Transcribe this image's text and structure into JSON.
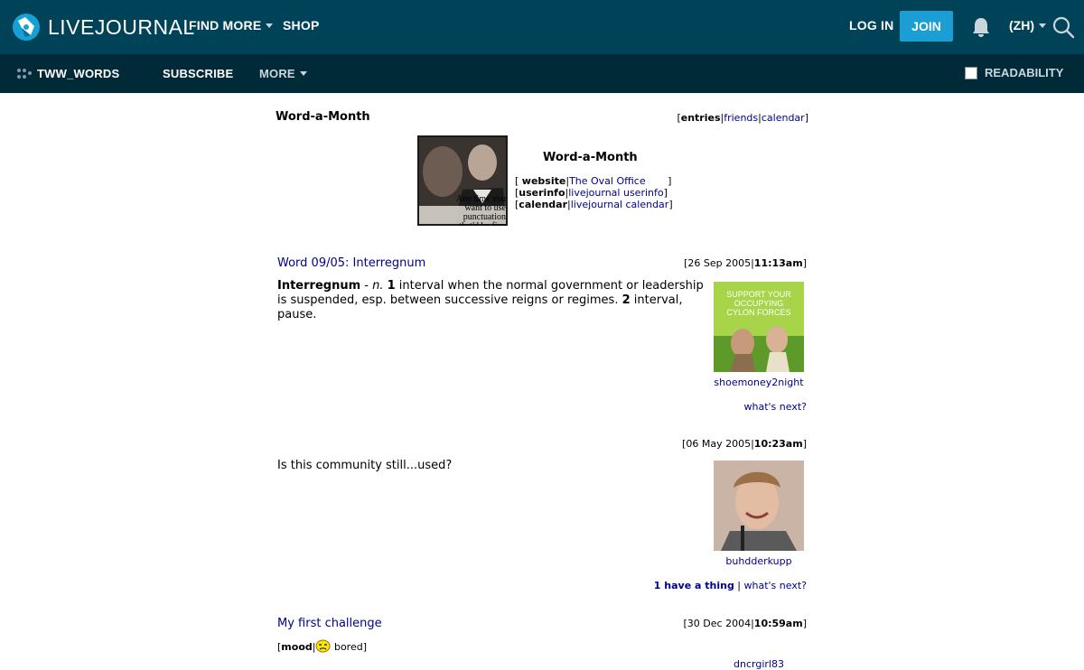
{
  "topnav": {
    "logo_text": "LIVEJOURNAL",
    "find_more": "FIND MORE",
    "shop": "SHOP",
    "login": "LOG IN",
    "join": "JOIN",
    "language": "(ZH)",
    "icons": [
      "livejournal-logo-icon",
      "bell-icon",
      "search-icon"
    ]
  },
  "subnav": {
    "journal_name": "TWW_WORDS",
    "subscribe": "SUBSCRIBE",
    "more": "MORE",
    "readability": "READABILITY"
  },
  "journal": {
    "title": "Word-a-Month",
    "links": {
      "entries": "entries",
      "friends": "friends",
      "calendar": "calendar"
    },
    "header": {
      "title": "Word-a-Month",
      "userpic_caption": "Any time you want to use punctuation that'd be fine",
      "rows": [
        {
          "label": "website",
          "value": "The Oval Office"
        },
        {
          "label": "userinfo",
          "value": "livejournal userinfo"
        },
        {
          "label": "calendar",
          "value": "livejournal calendar"
        }
      ]
    }
  },
  "entries": [
    {
      "subject": "Word 09/05: Interregnum",
      "date": "26 Sep 2005",
      "time": "11:13am",
      "body_term": "Interregnum",
      "body_pos": "n.",
      "body_n1": "1",
      "body_def1": "interval when the normal government or leadership is suspended, esp. between successive reigns or regimes.",
      "body_n2": "2",
      "body_def2": "interval, pause.",
      "userpic_caption": "SUPPORT YOUR OCCUPYING CYLON FORCES",
      "user": "shoemoney2night",
      "whats_next": "what's next?"
    },
    {
      "subject": "",
      "date": "06 May 2005",
      "time": "10:23am",
      "body": "Is this community still...used?",
      "user": "buhdderkupp",
      "comments": "1 have a thing",
      "whats_next": "what's next?"
    },
    {
      "subject": "My first challenge",
      "date": "30 Dec 2004",
      "time": "10:59am",
      "mood_label": "mood",
      "mood": "bored",
      "user": "dncrgirl83"
    }
  ],
  "colors": {
    "topbar": "#004359",
    "subbar": "#002a38",
    "join": "#1a9ed4",
    "link": "#00008b"
  }
}
